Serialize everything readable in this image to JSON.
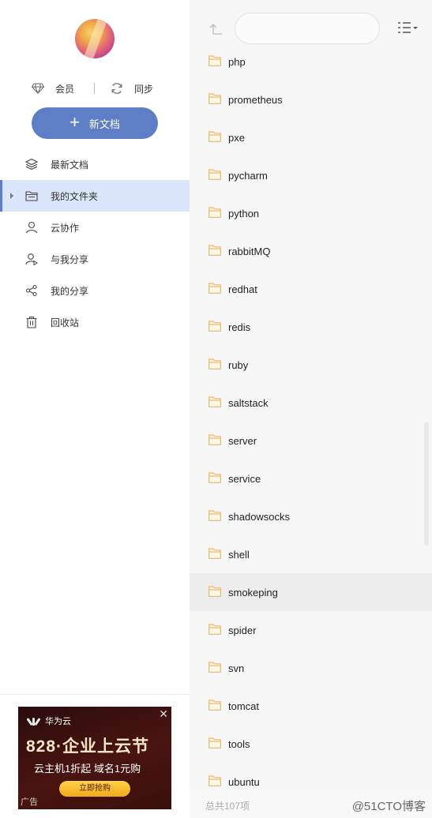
{
  "sidebar": {
    "member_label": "会员",
    "sync_label": "同步",
    "new_doc_label": "新文档",
    "nav": [
      {
        "label": "最新文档",
        "icon": "layers-icon"
      },
      {
        "label": "我的文件夹",
        "icon": "folder-icon"
      },
      {
        "label": "云协作",
        "icon": "user-icon"
      },
      {
        "label": "与我分享",
        "icon": "shared-with-me-icon"
      },
      {
        "label": "我的分享",
        "icon": "share-icon"
      },
      {
        "label": "回收站",
        "icon": "trash-icon"
      }
    ]
  },
  "ad": {
    "brand": "华为云",
    "title": "828·企业上云节",
    "subtitle": "云主机1折起  域名1元购",
    "button": "立即抢购",
    "tag": "广告"
  },
  "main": {
    "folders": [
      "php",
      "prometheus",
      "pxe",
      "pycharm",
      "python",
      "rabbitMQ",
      "redhat",
      "redis",
      "ruby",
      "saltstack",
      "server",
      "service",
      "shadowsocks",
      "shell",
      "smokeping",
      "spider",
      "svn",
      "tomcat",
      "tools",
      "ubuntu"
    ],
    "hovered_folder": "smokeping"
  },
  "footer": {
    "count_text": "总共107项",
    "watermark": "@51CTO博客"
  },
  "colors": {
    "accent": "#5e7ec6",
    "active_bg": "#d9e6f9",
    "folder": "#e8b86a"
  }
}
